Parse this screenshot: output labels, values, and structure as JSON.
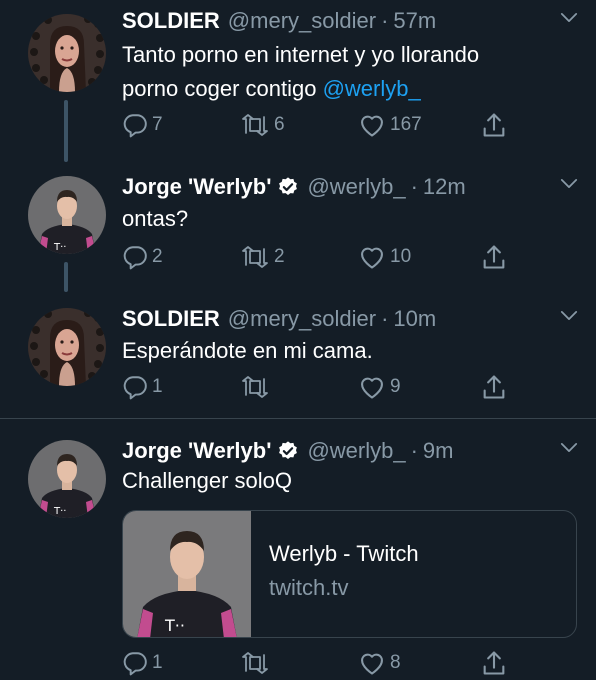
{
  "colors": {
    "background": "#141d26",
    "text": "#ffffff",
    "muted": "#8899a6",
    "link": "#1da1f2",
    "verified": "#ffffff",
    "separator": "#38444d"
  },
  "tweets": [
    {
      "name": "SOLDIER",
      "handle": "@mery_soldier",
      "dot": "·",
      "time": "57m",
      "verified": false,
      "text_line1": "Tanto porno en internet y yo llorando",
      "text_line2_prefix": "porno coger contigo ",
      "mention": "@werlyb_",
      "reply_count": "7",
      "retweet_count": "6",
      "like_count": "167"
    },
    {
      "name": "Jorge 'Werlyb'",
      "handle": "@werlyb_",
      "dot": "·",
      "time": "12m",
      "verified": true,
      "text": "ontas?",
      "reply_count": "2",
      "retweet_count": "2",
      "like_count": "10"
    },
    {
      "name": "SOLDIER",
      "handle": "@mery_soldier",
      "dot": "·",
      "time": "10m",
      "verified": false,
      "text": "Esperándote en mi cama.",
      "reply_count": "1",
      "retweet_count": "",
      "like_count": "9"
    },
    {
      "name": "Jorge 'Werlyb'",
      "handle": "@werlyb_",
      "dot": "·",
      "time": "9m",
      "verified": true,
      "text": "Challenger soloQ",
      "card_title": "Werlyb - Twitch",
      "card_domain": "twitch.tv",
      "reply_count": "1",
      "retweet_count": "",
      "like_count": "8"
    }
  ],
  "icons": {
    "reply": "reply-icon",
    "retweet": "retweet-icon",
    "like": "heart-icon",
    "share": "share-icon",
    "more": "chevron-down-icon",
    "verified": "verified-badge-icon"
  }
}
